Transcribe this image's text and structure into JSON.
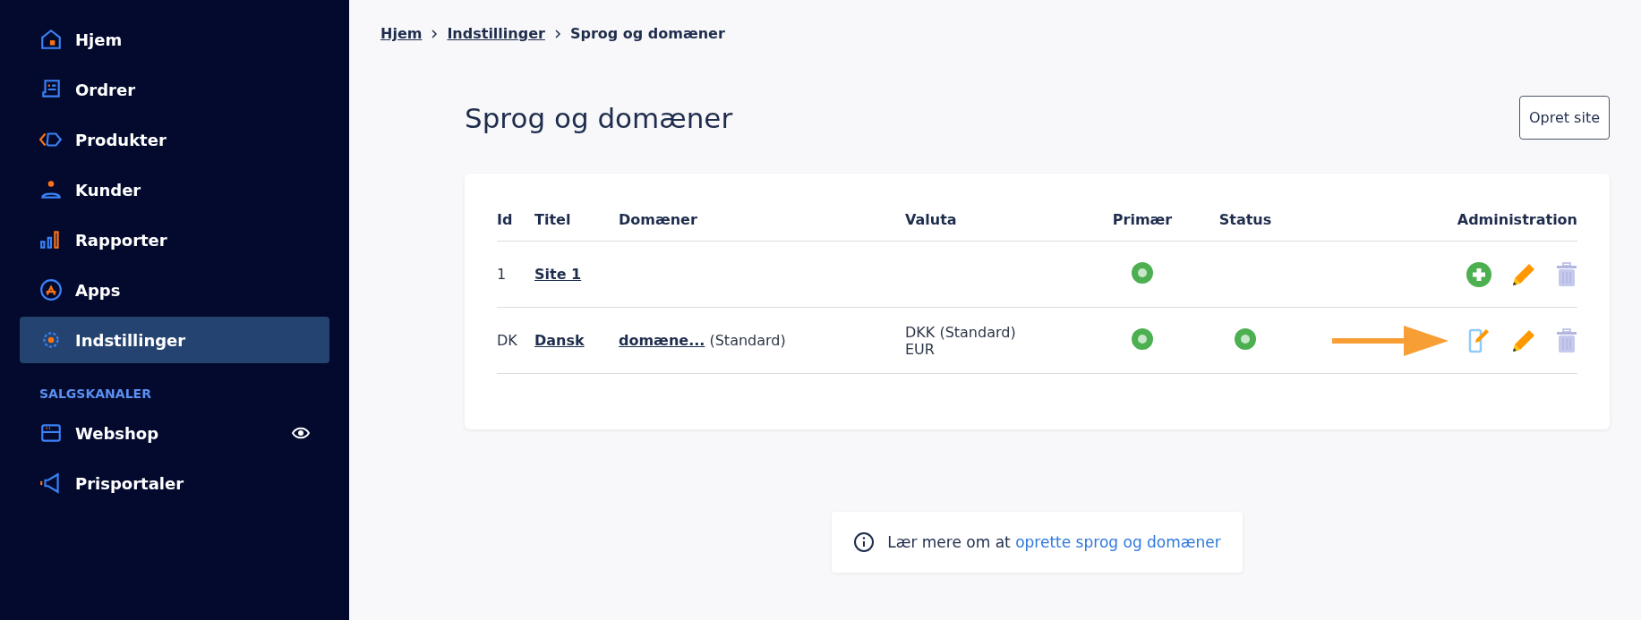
{
  "sidebar": {
    "items": [
      {
        "label": "Hjem",
        "kind": "home",
        "selected": false
      },
      {
        "label": "Ordrer",
        "kind": "orders",
        "selected": false
      },
      {
        "label": "Produkter",
        "kind": "tag",
        "selected": false
      },
      {
        "label": "Kunder",
        "kind": "person",
        "selected": false
      },
      {
        "label": "Rapporter",
        "kind": "bars",
        "selected": false
      },
      {
        "label": "Apps",
        "kind": "apps",
        "selected": false
      },
      {
        "label": "Indstillinger",
        "kind": "gear",
        "selected": true
      }
    ],
    "section_title": "SALGSKANALER",
    "channels": [
      {
        "label": "Webshop",
        "kind": "shop",
        "visible": true
      },
      {
        "label": "Prisportaler",
        "kind": "megaphone",
        "visible": false
      }
    ]
  },
  "breadcrumb": [
    {
      "label": "Hjem",
      "link": true
    },
    {
      "label": "Indstillinger",
      "link": true
    },
    {
      "label": "Sprog og domæner",
      "link": false
    }
  ],
  "page_title": "Sprog og domæner",
  "create_button": "Opret site",
  "table": {
    "columns": [
      "Id",
      "Titel",
      "Domæner",
      "Valuta",
      "Primær",
      "Status",
      "Administration"
    ],
    "rows": [
      {
        "id": "1",
        "title": "Site 1",
        "primary": true,
        "status": false,
        "actions": [
          {
            "kind": "add",
            "highlighted": false
          },
          {
            "kind": "edit",
            "highlighted": false
          },
          {
            "kind": "delete",
            "highlighted": false
          }
        ]
      },
      {
        "id": "DK",
        "title": "Dansk",
        "domain": "domæne...",
        "domain_note": "(Standard)",
        "currencies": [
          "DKK (Standard)",
          "EUR"
        ],
        "primary": true,
        "status": true,
        "actions": [
          {
            "kind": "edit-page",
            "highlighted": true
          },
          {
            "kind": "edit",
            "highlighted": false
          },
          {
            "kind": "delete",
            "highlighted": false
          }
        ]
      }
    ]
  },
  "help": {
    "text": "Lær mere om at",
    "link": "oprette sprog og domæner"
  }
}
